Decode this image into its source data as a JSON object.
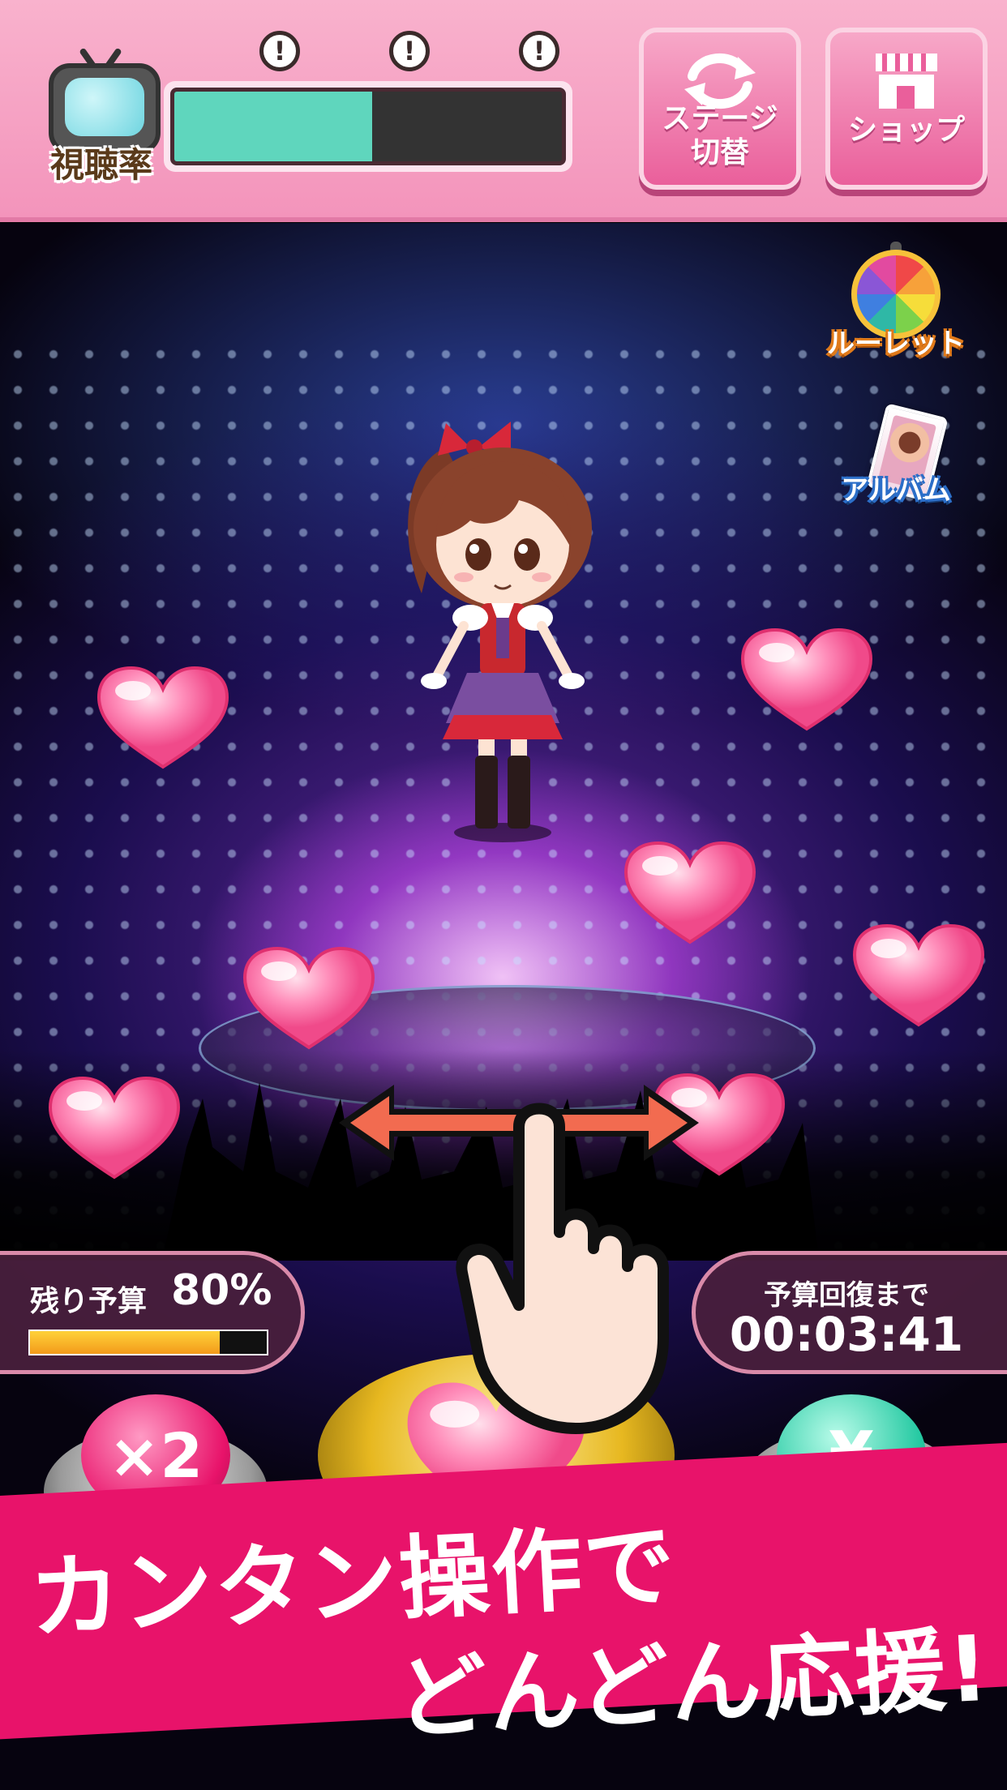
{
  "header": {
    "rating_label": "視聴率",
    "alert_marks": [
      "!",
      "!",
      "!"
    ],
    "rating_fill_fraction": 0.51,
    "stage_switch_label": "ステージ\n切替",
    "shop_label": "ショップ",
    "colors": {
      "header_bg": "#f6a1c4",
      "button_pink": "#ea5f9b",
      "rating_fill": "#5fd6bd"
    }
  },
  "side_menu": {
    "roulette_label": "ルーレット",
    "album_label": "アルバム"
  },
  "budget": {
    "remaining_label": "残り予算",
    "remaining_value": "80%",
    "remaining_fraction": 0.8,
    "recover_label": "予算回復まで",
    "recover_time": "00:03:41"
  },
  "buttons": {
    "double_label": "×2",
    "yen_label": "¥",
    "heart_button": "heart-icon"
  },
  "banner": {
    "line1": "カンタン操作で",
    "line2": "どんどん応援!",
    "color": "#e8136a"
  },
  "icons": [
    "tv-icon",
    "refresh-icon",
    "shop-icon",
    "roulette-icon",
    "album-icon",
    "heart-icon",
    "hand-pointer-icon",
    "swipe-arrow-icon",
    "yen-icon"
  ]
}
